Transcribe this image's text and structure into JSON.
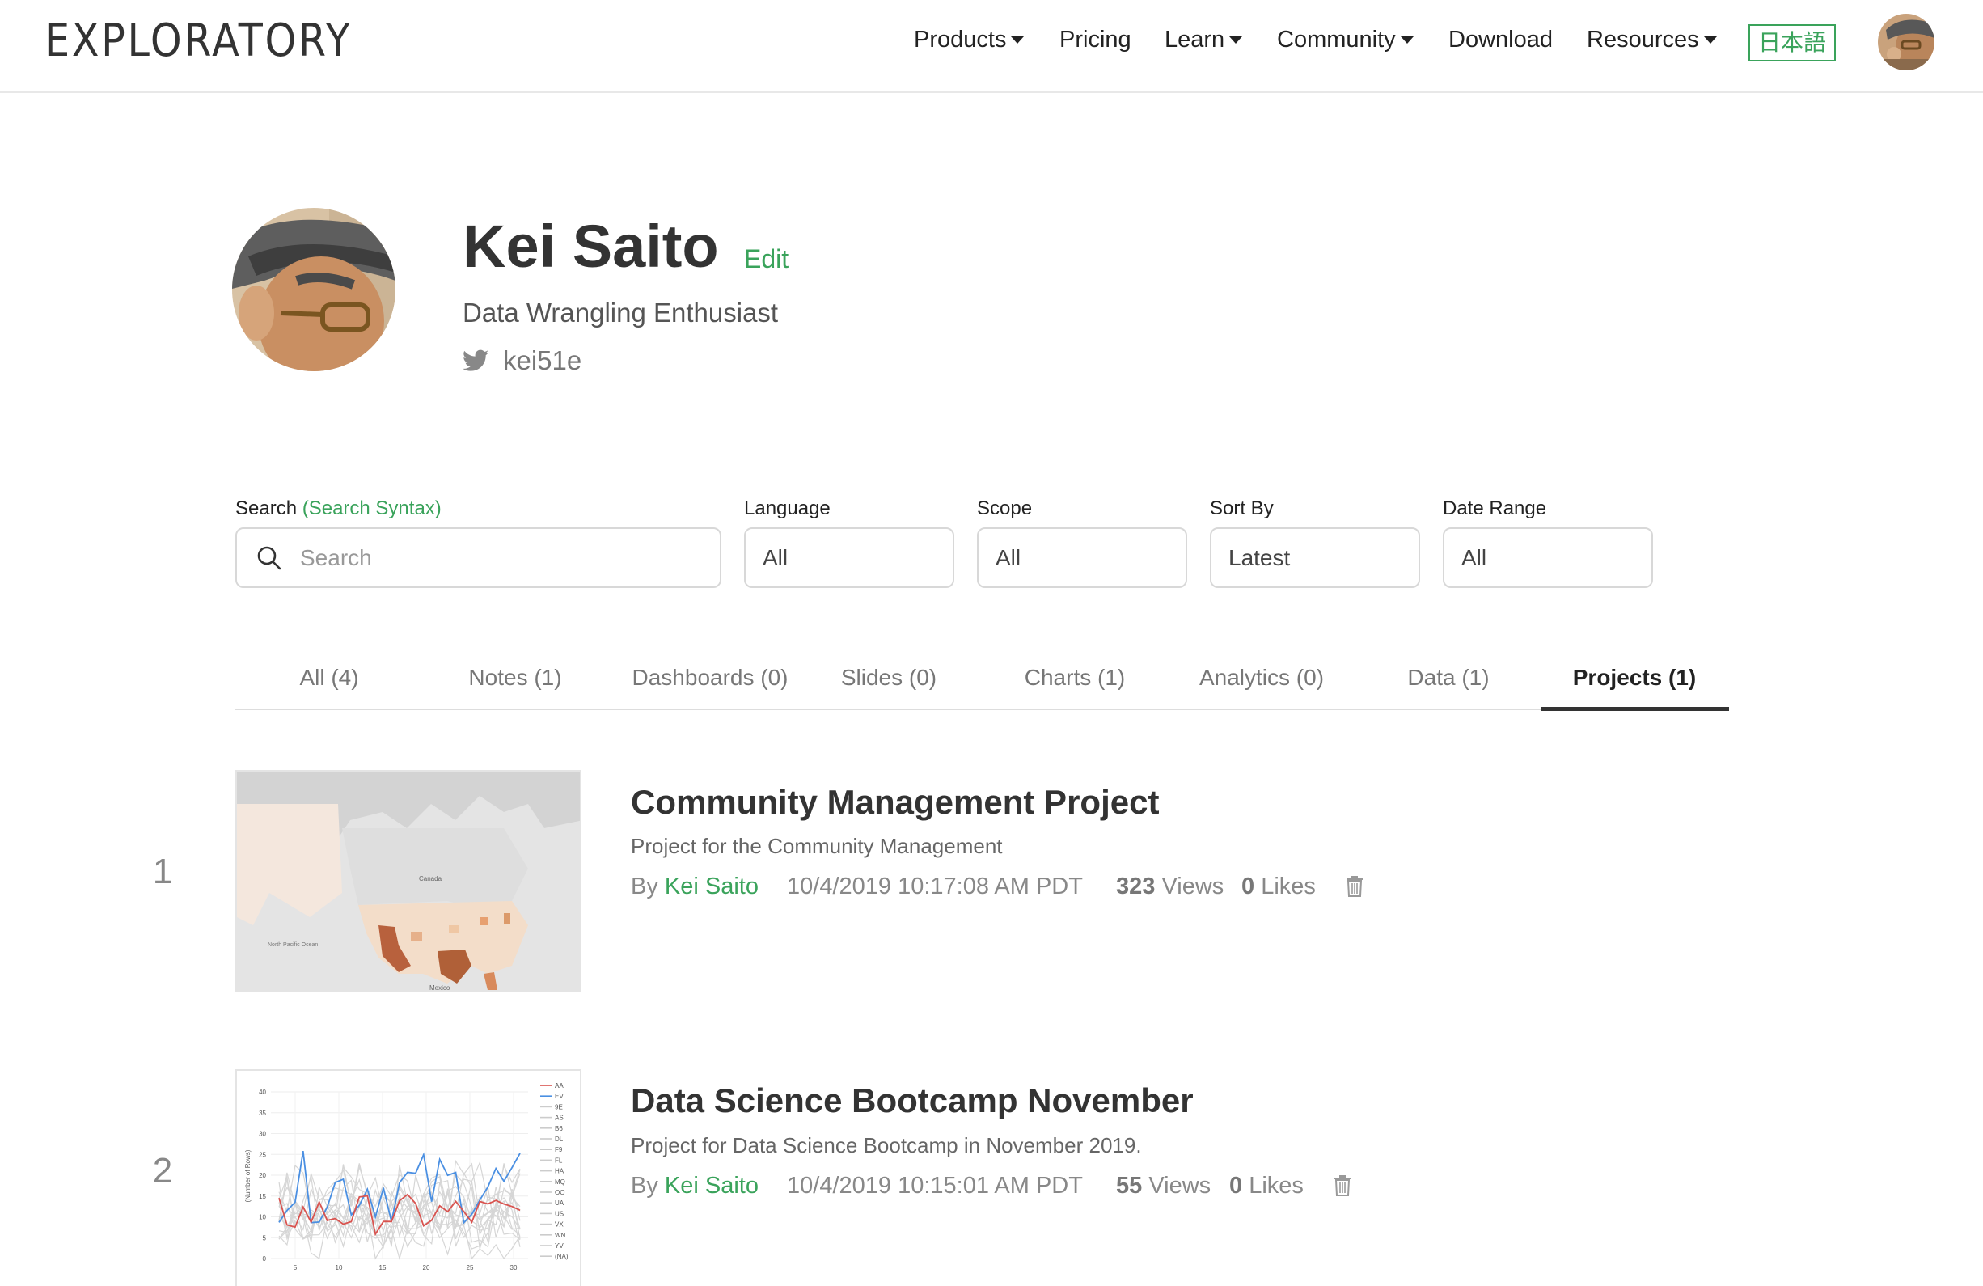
{
  "nav": {
    "logo": "EXPLORATORY",
    "items": [
      {
        "label": "Products",
        "has_caret": true
      },
      {
        "label": "Pricing",
        "has_caret": false
      },
      {
        "label": "Learn",
        "has_caret": true
      },
      {
        "label": "Community",
        "has_caret": true
      },
      {
        "label": "Download",
        "has_caret": false
      },
      {
        "label": "Resources",
        "has_caret": true
      }
    ],
    "language_button": "日本語",
    "avatar_icon": "user-avatar"
  },
  "profile": {
    "name": "Kei Saito",
    "edit_label": "Edit",
    "tagline": "Data Wrangling Enthusiast",
    "twitter_handle": "kei51e",
    "twitter_icon": "twitter-bird-icon"
  },
  "filters": {
    "search_label": "Search",
    "search_syntax_label": "(Search Syntax)",
    "search_placeholder": "Search",
    "language_label": "Language",
    "language_value": "All",
    "scope_label": "Scope",
    "scope_value": "All",
    "sort_label": "Sort By",
    "sort_value": "Latest",
    "date_label": "Date Range",
    "date_value": "All"
  },
  "tabs": [
    {
      "label": "All (4)",
      "active": false
    },
    {
      "label": "Notes (1)",
      "active": false
    },
    {
      "label": "Dashboards (0)",
      "active": false
    },
    {
      "label": "Slides (0)",
      "active": false
    },
    {
      "label": "Charts (1)",
      "active": false
    },
    {
      "label": "Analytics (0)",
      "active": false
    },
    {
      "label": "Data (1)",
      "active": false
    },
    {
      "label": "Projects (1)",
      "active": true
    }
  ],
  "items": [
    {
      "number": "1",
      "title": "Community Management Project",
      "description": "Project for the Community Management",
      "by_label": "By",
      "author": "Kei Saito",
      "timestamp": "10/4/2019 10:17:08 AM PDT",
      "views": "323",
      "views_label": "Views",
      "likes": "0",
      "likes_label": "Likes",
      "thumbnail": "map-thumbnail"
    },
    {
      "number": "2",
      "title": "Data Science Bootcamp November",
      "description": "Project for Data Science Bootcamp in November 2019.",
      "by_label": "By",
      "author": "Kei Saito",
      "timestamp": "10/4/2019 10:15:01 AM PDT",
      "views": "55",
      "views_label": "Views",
      "likes": "0",
      "likes_label": "Likes",
      "thumbnail": "line-chart-thumbnail"
    }
  ],
  "map_labels": [
    "Canada",
    "Mexico",
    "North Pacific Ocean"
  ],
  "chart_thumb": {
    "yticks": [
      "0",
      "5",
      "10",
      "15",
      "20",
      "25",
      "30",
      "35",
      "40"
    ],
    "xticks": [
      "5",
      "10",
      "15",
      "20",
      "25",
      "30"
    ],
    "ylabel": "(Number of Rows)",
    "legend": [
      "AA",
      "EV",
      "9E",
      "AS",
      "B6",
      "DL",
      "F9",
      "FL",
      "HA",
      "MQ",
      "OO",
      "UA",
      "US",
      "VX",
      "WN",
      "YV",
      "(NA)"
    ]
  },
  "colors": {
    "accent": "#3aa35b",
    "text": "#333333",
    "muted": "#888888"
  }
}
